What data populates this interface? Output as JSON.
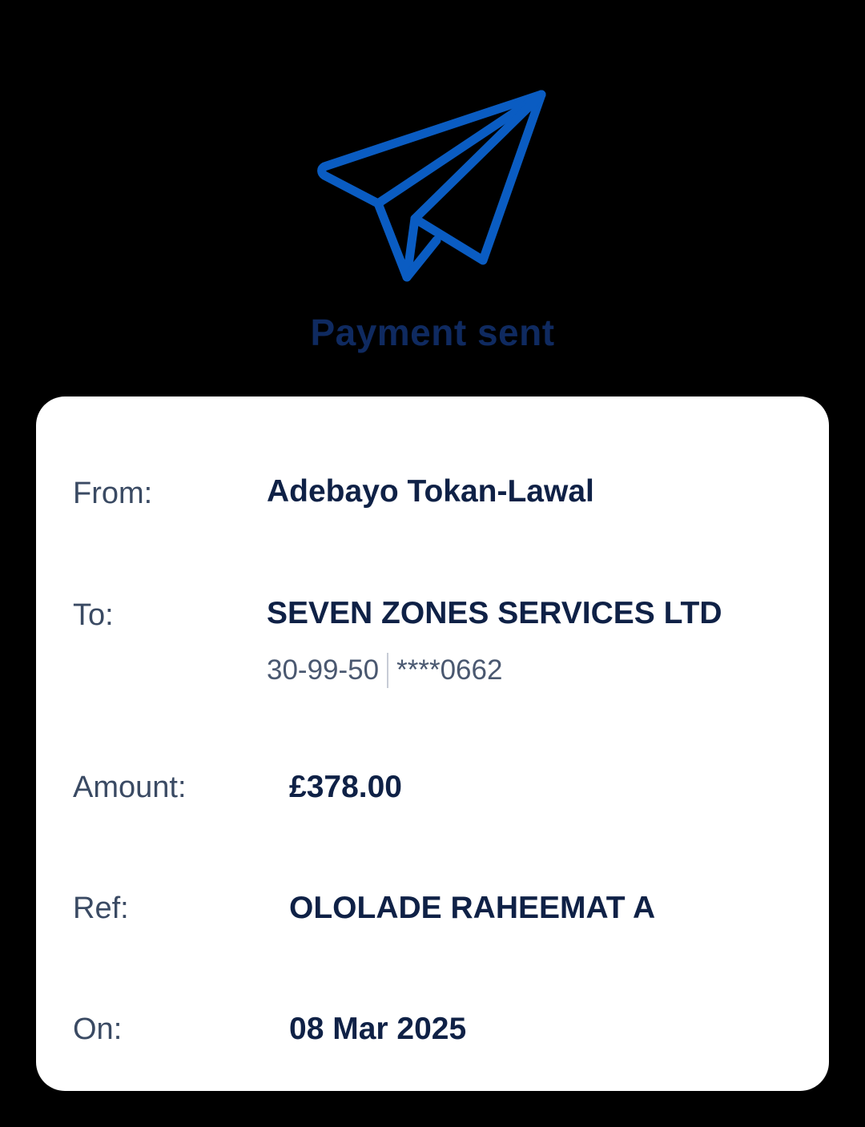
{
  "header": {
    "icon": "paper-plane-icon",
    "title": "Payment sent",
    "accent_color": "#0a5cc2",
    "title_color": "#0f2a60"
  },
  "details": {
    "from": {
      "label": "From:",
      "value": "Adebayo Tokan-Lawal"
    },
    "to": {
      "label": "To:",
      "value": "SEVEN ZONES SERVICES LTD",
      "sort_code": "30-99-50",
      "account": "****0662"
    },
    "amount": {
      "label": "Amount:",
      "value": "£378.00"
    },
    "ref": {
      "label": "Ref:",
      "value": "OLOLADE RAHEEMAT A"
    },
    "on": {
      "label": "On:",
      "value": "08 Mar 2025"
    }
  }
}
